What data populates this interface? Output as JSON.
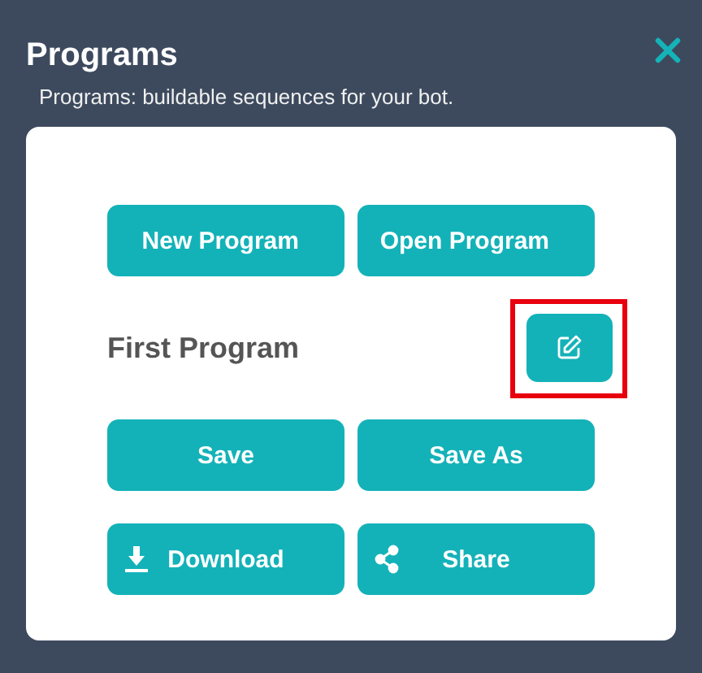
{
  "window": {
    "title": "Programs",
    "subtitle": "Programs: buildable sequences for your bot."
  },
  "top_buttons": [
    {
      "label": "New Program"
    },
    {
      "label": "Open Program"
    }
  ],
  "program": {
    "name": "First Program",
    "edit_button": {
      "highlighted": true
    }
  },
  "bottom_buttons": [
    {
      "label": "Save",
      "kind": "plain"
    },
    {
      "label": "Save As",
      "kind": "plain"
    },
    {
      "label": "Download",
      "kind": "download"
    },
    {
      "label": "Share",
      "kind": "share"
    }
  ]
}
